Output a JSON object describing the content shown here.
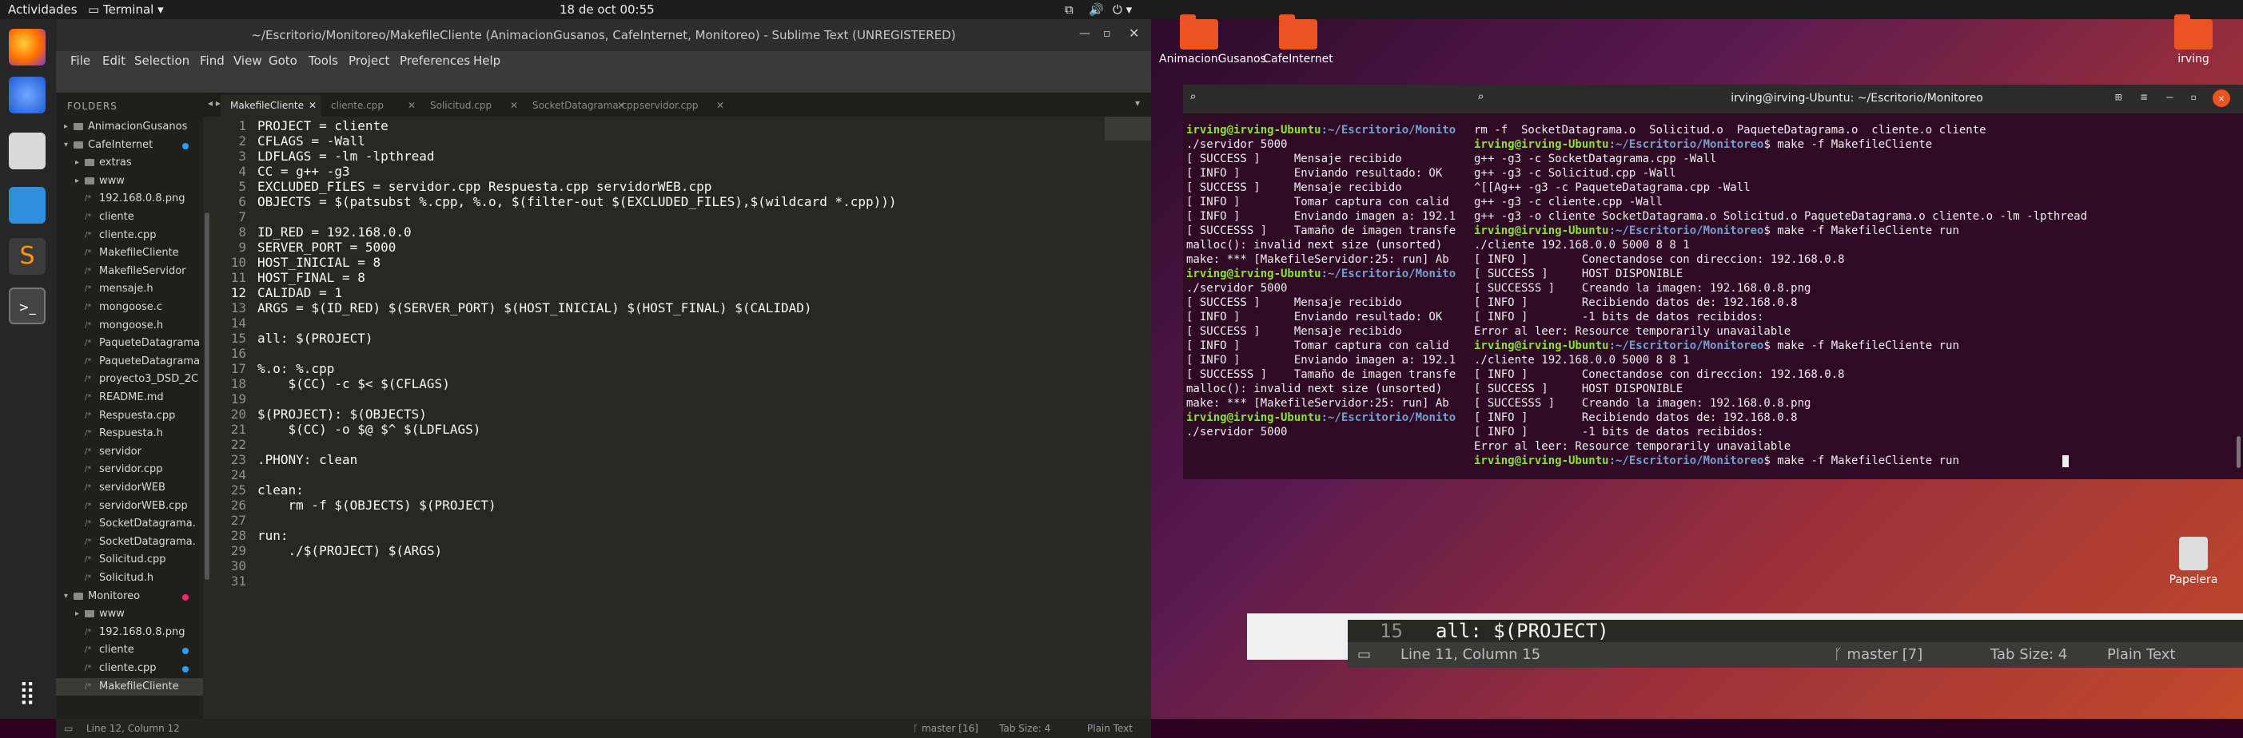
{
  "topbar": {
    "activities": "Actividades",
    "app": "Terminal",
    "clock": "18 de oct  00:55"
  },
  "dock": {
    "items": [
      "firefox-icon",
      "thunderbird-icon",
      "files-icon",
      "writer-icon",
      "sublime-icon",
      "terminal-icon"
    ],
    "apps_grid": "apps-grid-icon"
  },
  "sublime": {
    "title": "~/Escritorio/Monitoreo/MakefileCliente (AnimacionGusanos, CafeInternet, Monitoreo) - Sublime Text (UNREGISTERED)",
    "menu": [
      "File",
      "Edit",
      "Selection",
      "Find",
      "View",
      "Goto",
      "Tools",
      "Project",
      "Preferences",
      "Help"
    ],
    "folders_header": "FOLDERS",
    "tree": [
      {
        "label": "AnimacionGusanos",
        "level": 0,
        "kind": "folder",
        "open": false
      },
      {
        "label": "CafeInternet",
        "level": 0,
        "kind": "folder",
        "open": true,
        "dot": "#2aa1f1"
      },
      {
        "label": "extras",
        "level": 1,
        "kind": "folder",
        "open": false
      },
      {
        "label": "www",
        "level": 1,
        "kind": "folder",
        "open": false
      },
      {
        "label": "192.168.0.8.png",
        "level": 1,
        "kind": "file"
      },
      {
        "label": "cliente",
        "level": 1,
        "kind": "file"
      },
      {
        "label": "cliente.cpp",
        "level": 1,
        "kind": "file"
      },
      {
        "label": "MakefileCliente",
        "level": 1,
        "kind": "file"
      },
      {
        "label": "MakefileServidor",
        "level": 1,
        "kind": "file"
      },
      {
        "label": "mensaje.h",
        "level": 1,
        "kind": "file"
      },
      {
        "label": "mongoose.c",
        "level": 1,
        "kind": "file"
      },
      {
        "label": "mongoose.h",
        "level": 1,
        "kind": "file"
      },
      {
        "label": "PaqueteDatagrama",
        "level": 1,
        "kind": "file"
      },
      {
        "label": "PaqueteDatagrama",
        "level": 1,
        "kind": "file"
      },
      {
        "label": "proyecto3_DSD_2C",
        "level": 1,
        "kind": "file"
      },
      {
        "label": "README.md",
        "level": 1,
        "kind": "file"
      },
      {
        "label": "Respuesta.cpp",
        "level": 1,
        "kind": "file"
      },
      {
        "label": "Respuesta.h",
        "level": 1,
        "kind": "file"
      },
      {
        "label": "servidor",
        "level": 1,
        "kind": "file"
      },
      {
        "label": "servidor.cpp",
        "level": 1,
        "kind": "file"
      },
      {
        "label": "servidorWEB",
        "level": 1,
        "kind": "file"
      },
      {
        "label": "servidorWEB.cpp",
        "level": 1,
        "kind": "file"
      },
      {
        "label": "SocketDatagrama.",
        "level": 1,
        "kind": "file"
      },
      {
        "label": "SocketDatagrama.",
        "level": 1,
        "kind": "file"
      },
      {
        "label": "Solicitud.cpp",
        "level": 1,
        "kind": "file"
      },
      {
        "label": "Solicitud.h",
        "level": 1,
        "kind": "file"
      },
      {
        "label": "Monitoreo",
        "level": 0,
        "kind": "folder",
        "open": true,
        "dot": "#f92672"
      },
      {
        "label": "www",
        "level": 1,
        "kind": "folder",
        "open": false
      },
      {
        "label": "192.168.0.8.png",
        "level": 1,
        "kind": "file"
      },
      {
        "label": "cliente",
        "level": 1,
        "kind": "file",
        "dot": "#2aa1f1"
      },
      {
        "label": "cliente.cpp",
        "level": 1,
        "kind": "file",
        "dot": "#2aa1f1"
      },
      {
        "label": "MakefileCliente",
        "level": 1,
        "kind": "file",
        "active": true
      }
    ],
    "tabs": [
      {
        "label": "MakefileCliente",
        "active": true
      },
      {
        "label": "cliente.cpp"
      },
      {
        "label": "Solicitud.cpp"
      },
      {
        "label": "SocketDatagrama.cpp"
      },
      {
        "label": "servidor.cpp"
      }
    ],
    "code": [
      "PROJECT = cliente",
      "CFLAGS = -Wall",
      "LDFLAGS = -lm -lpthread",
      "CC = g++ -g3",
      "EXCLUDED_FILES = servidor.cpp Respuesta.cpp servidorWEB.cpp",
      "OBJECTS = $(patsubst %.cpp, %.o, $(filter-out $(EXCLUDED_FILES),$(wildcard *.cpp)))",
      "",
      "ID_RED = 192.168.0.0",
      "SERVER_PORT = 5000",
      "HOST_INICIAL = 8",
      "HOST_FINAL = 8",
      "CALIDAD = 1",
      "ARGS = $(ID_RED) $(SERVER_PORT) $(HOST_INICIAL) $(HOST_FINAL) $(CALIDAD)",
      "",
      "all: $(PROJECT)",
      "",
      "%.o: %.cpp",
      "    $(CC) -c $< $(CFLAGS)",
      "",
      "$(PROJECT): $(OBJECTS)",
      "    $(CC) -o $@ $^ $(LDFLAGS)",
      "",
      ".PHONY: clean",
      "",
      "clean:",
      "    rm -f $(OBJECTS) $(PROJECT)",
      "",
      "run:",
      "    ./$(PROJECT) $(ARGS)",
      "",
      ""
    ],
    "current_line": 12,
    "status": {
      "position": "Line 12, Column 12",
      "branch": "master",
      "branch_count": "16",
      "tab_size": "Tab Size: 4",
      "syntax": "Plain Text"
    }
  },
  "desktop": {
    "icons": [
      {
        "label": "AnimacionGusanos"
      },
      {
        "label": "CafeInternet"
      },
      {
        "label": "irving"
      },
      {
        "label": "Papelera"
      }
    ]
  },
  "term_back": {
    "prompt_user": "irving@irving-Ubuntu",
    "prompt_path": ":~/Escritorio/Monito",
    "lines": [
      {
        "t": "prompt",
        "text": ""
      },
      {
        "t": "out",
        "text": "./servidor 5000"
      },
      {
        "t": "out",
        "text": "[ SUCCESS ]     Mensaje recibido"
      },
      {
        "t": "out",
        "text": "[ INFO ]        Enviando resultado: OK"
      },
      {
        "t": "out",
        "text": "[ SUCCESS ]     Mensaje recibido"
      },
      {
        "t": "out",
        "text": "[ INFO ]        Tomar captura con calid"
      },
      {
        "t": "out",
        "text": "[ INFO ]        Enviando imagen a: 192.1"
      },
      {
        "t": "out",
        "text": "[ SUCCESSS ]    Tamaño de imagen transfe"
      },
      {
        "t": "out",
        "text": "malloc(): invalid next size (unsorted)"
      },
      {
        "t": "out",
        "text": "make: *** [MakefileServidor:25: run] Ab"
      },
      {
        "t": "prompt",
        "text": ""
      },
      {
        "t": "out",
        "text": "./servidor 5000"
      },
      {
        "t": "out",
        "text": "[ SUCCESS ]     Mensaje recibido"
      },
      {
        "t": "out",
        "text": "[ INFO ]        Enviando resultado: OK"
      },
      {
        "t": "out",
        "text": "[ SUCCESS ]     Mensaje recibido"
      },
      {
        "t": "out",
        "text": "[ INFO ]        Tomar captura con calid"
      },
      {
        "t": "out",
        "text": "[ INFO ]        Enviando imagen a: 192.1"
      },
      {
        "t": "out",
        "text": "[ SUCCESSS ]    Tamaño de imagen transfe"
      },
      {
        "t": "out",
        "text": "malloc(): invalid next size (unsorted)"
      },
      {
        "t": "out",
        "text": "make: *** [MakefileServidor:25: run] Ab"
      },
      {
        "t": "prompt",
        "text": ""
      },
      {
        "t": "out",
        "text": "./servidor 5000"
      }
    ]
  },
  "term_front": {
    "title": "irving@irving-Ubuntu: ~/Escritorio/Monitoreo",
    "prompt_user": "irving@irving-Ubuntu",
    "prompt_path": ":~/Escritorio/Monitoreo",
    "lines": [
      {
        "t": "out",
        "text": "rm -f  SocketDatagrama.o  Solicitud.o  PaqueteDatagrama.o  cliente.o cliente"
      },
      {
        "t": "prompt",
        "text": "$ make -f MakefileCliente"
      },
      {
        "t": "out",
        "text": "g++ -g3 -c SocketDatagrama.cpp -Wall"
      },
      {
        "t": "out",
        "text": "g++ -g3 -c Solicitud.cpp -Wall"
      },
      {
        "t": "out",
        "text": "^[[Ag++ -g3 -c PaqueteDatagrama.cpp -Wall"
      },
      {
        "t": "out",
        "text": "g++ -g3 -c cliente.cpp -Wall"
      },
      {
        "t": "out",
        "text": "g++ -g3 -o cliente SocketDatagrama.o Solicitud.o PaqueteDatagrama.o cliente.o -lm -lpthread"
      },
      {
        "t": "prompt",
        "text": "$ make -f MakefileCliente run"
      },
      {
        "t": "out",
        "text": "./cliente 192.168.0.0 5000 8 8 1"
      },
      {
        "t": "out",
        "text": "[ INFO ]        Conectandose con direccion: 192.168.0.8"
      },
      {
        "t": "out",
        "text": "[ SUCCESS ]     HOST DISPONIBLE"
      },
      {
        "t": "out",
        "text": "[ SUCCESSS ]    Creando la imagen: 192.168.0.8.png"
      },
      {
        "t": "out",
        "text": "[ INFO ]        Recibiendo datos de: 192.168.0.8"
      },
      {
        "t": "out",
        "text": "[ INFO ]        -1 bits de datos recibidos:"
      },
      {
        "t": "out",
        "text": "Error al leer: Resource temporarily unavailable"
      },
      {
        "t": "prompt",
        "text": "$ make -f MakefileCliente run"
      },
      {
        "t": "out",
        "text": "./cliente 192.168.0.0 5000 8 8 1"
      },
      {
        "t": "out",
        "text": "[ INFO ]        Conectandose con direccion: 192.168.0.8"
      },
      {
        "t": "out",
        "text": "[ SUCCESS ]     HOST DISPONIBLE"
      },
      {
        "t": "out",
        "text": "[ SUCCESSS ]    Creando la imagen: 192.168.0.8.png"
      },
      {
        "t": "out",
        "text": "[ INFO ]        Recibiendo datos de: 192.168.0.8"
      },
      {
        "t": "out",
        "text": "[ INFO ]        -1 bits de datos recibidos:"
      },
      {
        "t": "out",
        "text": "Error al leer: Resource temporarily unavailable"
      },
      {
        "t": "prompt",
        "text": "$ make -f MakefileCliente run"
      }
    ]
  },
  "bg_strip": {
    "line_no": "15",
    "code": "all: $(PROJECT)",
    "position": "Line 11, Column 15",
    "branch": "master",
    "branch_count": "7",
    "tab_size": "Tab Size: 4",
    "syntax": "Plain Text"
  }
}
